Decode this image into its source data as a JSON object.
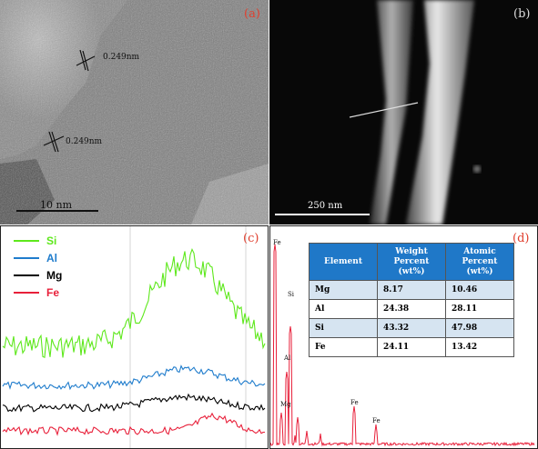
{
  "panel_a": {
    "label": "(a)",
    "lattice_1": "0.249nm",
    "lattice_2": "0.249nm",
    "scale_bar": "10 nm"
  },
  "panel_b": {
    "label": "(b)",
    "scale_bar": "250 nm"
  },
  "panel_c": {
    "label": "(c)",
    "legend": [
      {
        "name": "Si",
        "color": "#5ee81c"
      },
      {
        "name": "Al",
        "color": "#1f7ccc"
      },
      {
        "name": "Mg",
        "color": "#000000"
      },
      {
        "name": "Fe",
        "color": "#e8203a"
      }
    ]
  },
  "panel_d": {
    "label": "(d)",
    "peak_labels": [
      "Fe",
      "Si",
      "Al",
      "Mg",
      "Fe",
      "Fe"
    ],
    "peak_color": "#e8203a",
    "table": {
      "headers": [
        "Element",
        "Weight\nPercent\n(wt%)",
        "Atomic\nPercent\n(wt%)"
      ],
      "rows": [
        [
          "Mg",
          "8.17",
          "10.46"
        ],
        [
          "Al",
          "24.38",
          "28.11"
        ],
        [
          "Si",
          "43.32",
          "47.98"
        ],
        [
          "Fe",
          "24.11",
          "13.42"
        ]
      ]
    },
    "header_color": "#1f78c8"
  }
}
